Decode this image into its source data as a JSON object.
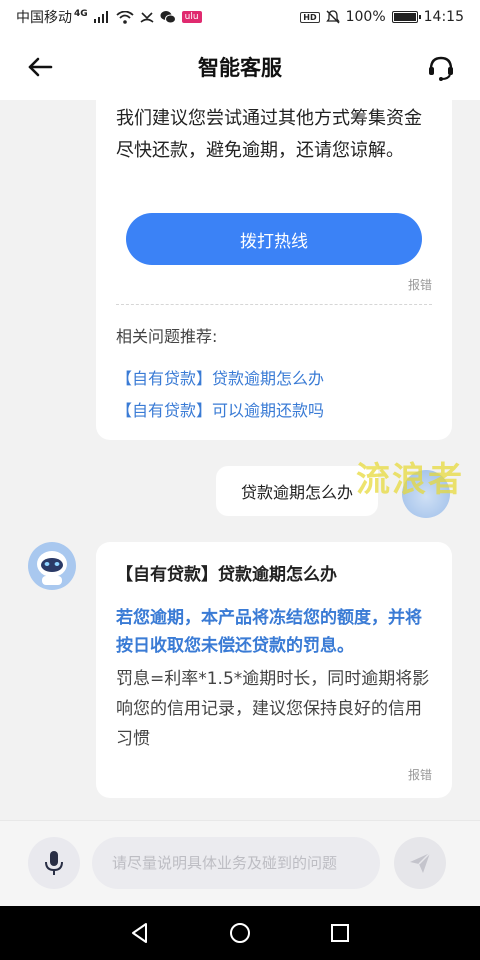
{
  "status_bar": {
    "carrier": "中国移动",
    "network": "4G",
    "battery": "100%",
    "battery_level": 1.0,
    "time": "14:15",
    "hd_label": "HD",
    "badge": "ulu"
  },
  "header": {
    "title": "智能客服",
    "back_icon": "arrow-left-icon",
    "agent_icon": "headset-icon"
  },
  "bot_message_1": {
    "text": "我们建议您尝试通过其他方式筹集资金尽快还款，避免逾期，还请您谅解。",
    "hotline_button": "拨打热线",
    "report_label": "报错",
    "related_title": "相关问题推荐:",
    "related": [
      "【自有贷款】贷款逾期怎么办",
      "【自有贷款】可以逾期还款吗"
    ]
  },
  "user_message": {
    "text": "贷款逾期怎么办"
  },
  "watermark": "流浪者",
  "bot_message_2": {
    "title": "【自有贷款】贷款逾期怎么办",
    "highlight": "若您逾期，本产品将冻结您的额度，并将按日收取您未偿还贷款的罚息。",
    "body": "罚息=利率*1.5*逾期时长，同时逾期将影响您的信用记录，建议您保持良好的信用习惯",
    "report_label": "报错"
  },
  "input_bar": {
    "placeholder": "请尽量说明具体业务及碰到的问题",
    "mic_icon": "microphone-icon",
    "send_icon": "send-icon"
  },
  "nav_bar": {
    "icons": [
      "nav-back-icon",
      "nav-home-icon",
      "nav-recents-icon"
    ]
  }
}
